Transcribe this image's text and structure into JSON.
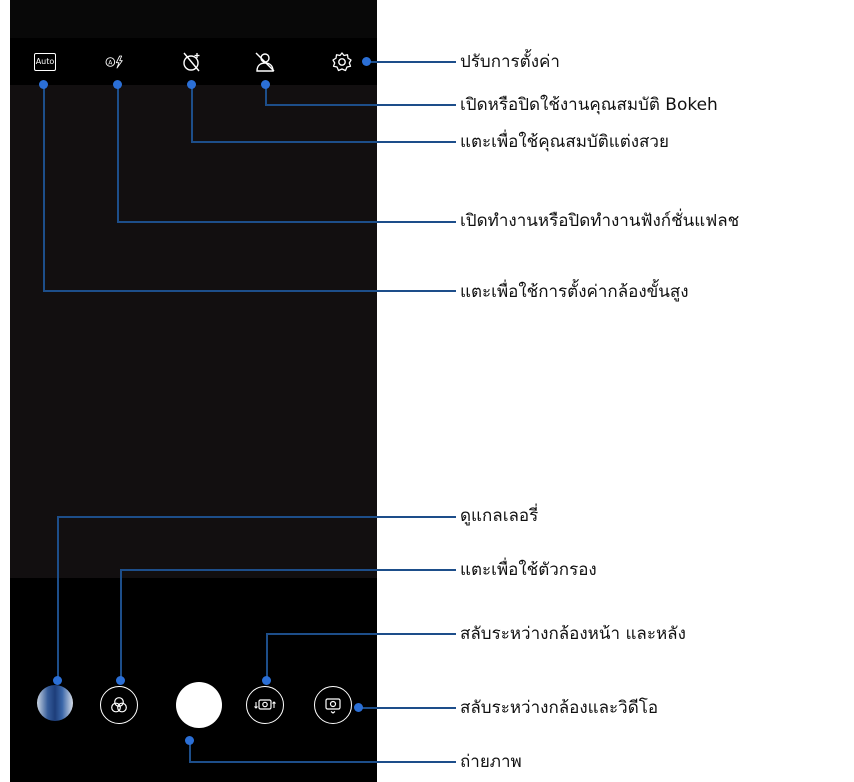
{
  "camera": {
    "top_bar": {
      "auto_badge": "Auto",
      "icons": [
        "flash-auto-icon",
        "beauty-off-icon",
        "bokeh-off-icon",
        "gear-icon"
      ]
    },
    "bottom_bar": {
      "icons": [
        "gallery-thumbnail",
        "filter-icon",
        "shutter-button",
        "switch-camera-icon",
        "camera-video-toggle-icon"
      ]
    }
  },
  "annotations": {
    "settings": "ปรับการตั้งค่า",
    "bokeh": "เปิดหรือปิดใช้งานคุณสมบัติ Bokeh",
    "beauty": "แตะเพื่อใช้คุณสมบัติแต่งสวย",
    "flash": "เปิดทำงานหรือปิดทำงานฟังก์ชั่นแฟลช",
    "advanced": "แตะเพื่อใช้การตั้งค่ากล้องขั้นสูง",
    "gallery": "ดูแกลเลอรี่",
    "filter": "แตะเพื่อใช้ตัวกรอง",
    "switch_camera": "สลับระหว่างกล้องหน้า และหลัง",
    "camera_video": "สลับระหว่างกล้องและวิดีโอ",
    "shutter": "ถ่ายภาพ"
  },
  "colors": {
    "accent": "#2b6fd6",
    "line": "#1d4e8a",
    "bar": "#000000",
    "viewfinder": "#120f10"
  }
}
